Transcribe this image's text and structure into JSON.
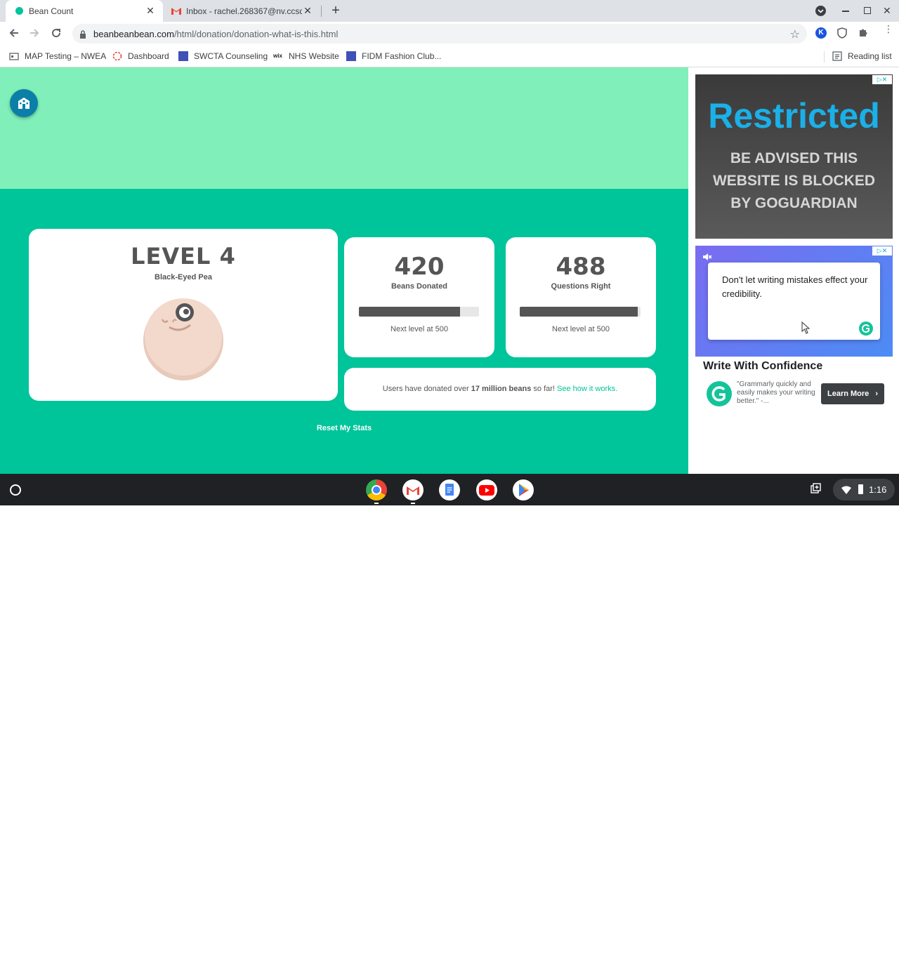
{
  "tabs": [
    {
      "title": "Bean Count",
      "active": true
    },
    {
      "title": "Inbox - rachel.268367@nv.ccsd.",
      "active": false
    }
  ],
  "toolbar": {
    "url_host": "beanbeanbean.com",
    "url_path": "/html/donation/donation-what-is-this.html",
    "profile_initial": "K"
  },
  "bookmarks": [
    "MAP Testing – NWEA",
    "Dashboard",
    "SWCTA Counseling",
    "NHS Website",
    "FIDM Fashion Club..."
  ],
  "reading_list": "Reading list",
  "level_card": {
    "level": "LEVEL 4",
    "bean_name": "Black-Eyed Pea"
  },
  "beans": {
    "value": "420",
    "label": "Beans Donated",
    "next": "Next level at 500",
    "progress": 0.84
  },
  "questions": {
    "value": "488",
    "label": "Questions Right",
    "next": "Next level at 500",
    "progress": 0.976
  },
  "donation_info": {
    "prefix": "Users have donated over",
    "amount": "17 million beans",
    "suffix": "so far!",
    "link": "See how it works."
  },
  "reset_label": "Reset My Stats",
  "ad_restricted": {
    "title": "Restricted",
    "body": "BE ADVISED THIS WEBSITE IS BLOCKED BY GOGUARDIAN"
  },
  "ad_grammarly": {
    "popup_text": "Don't let writing mistakes effect your credibility.",
    "headline": "Write With Confidence",
    "quote": "\"Grammarly quickly and easily makes your writing better.\" -...",
    "cta": "Learn More"
  },
  "tray": {
    "time": "1:16"
  },
  "colors": {
    "page_bg": "#00c49a",
    "hero_bg": "#80efb9",
    "link": "#00c49a",
    "restricted_blue": "#1ab0e8"
  }
}
